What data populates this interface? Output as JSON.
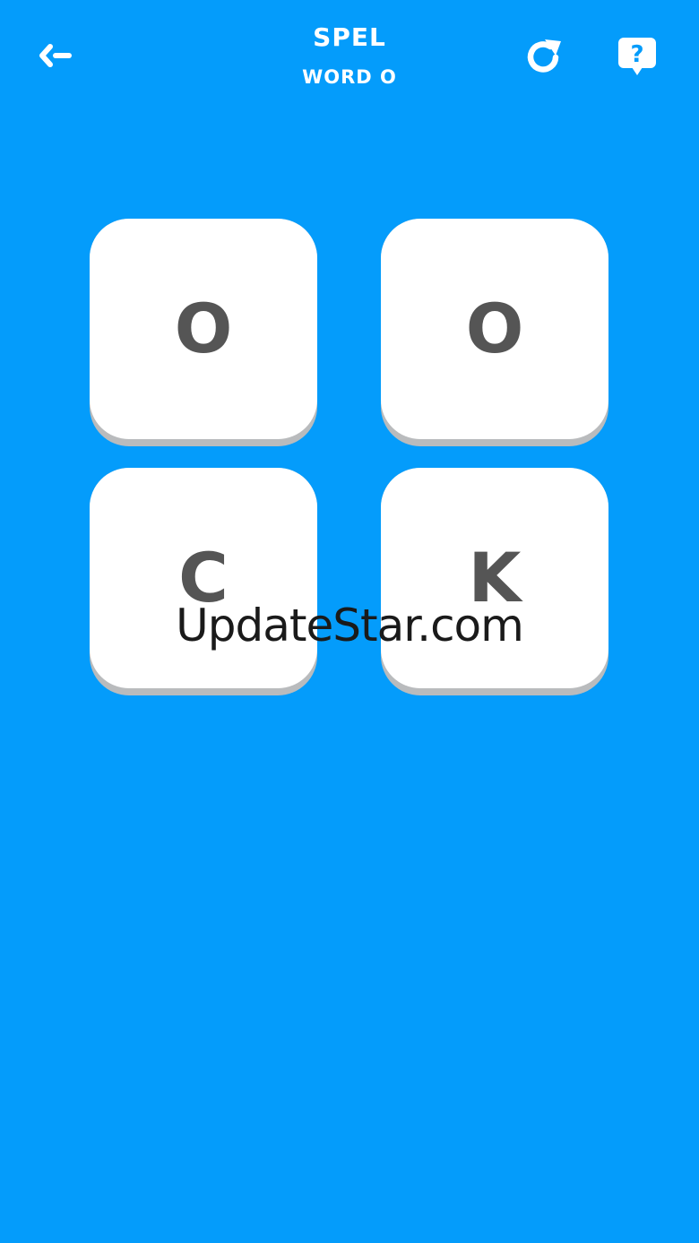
{
  "header": {
    "title": "SPEL",
    "subtitle": "WORD O",
    "back_icon": "back-arrow-icon",
    "restart_icon": "restart-icon",
    "help_icon": "help-question-icon"
  },
  "tiles": [
    {
      "letter": "O"
    },
    {
      "letter": "O"
    },
    {
      "letter": "C"
    },
    {
      "letter": "K"
    }
  ],
  "watermark": "UpdateStar.com",
  "colors": {
    "background": "#049cfb",
    "tile": "#ffffff",
    "tile_shadow": "#b9bbbd",
    "letter": "#555555",
    "header_text": "#ffffff"
  }
}
